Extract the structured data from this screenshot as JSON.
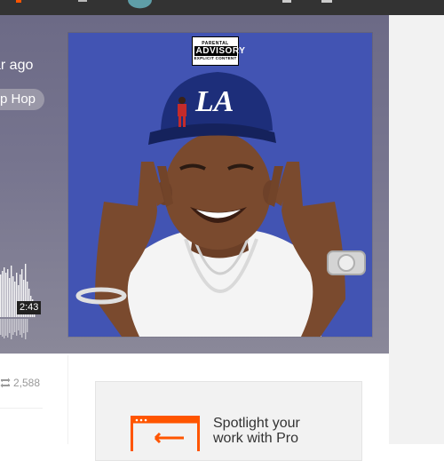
{
  "track": {
    "posted_ago": "ar ago",
    "genre_tag": "p Hop",
    "duration": "2:43"
  },
  "artwork": {
    "advisory_top": "PARENTAL",
    "advisory_middle": "ADVISORY",
    "advisory_bottom": "EXPLICIT CONTENT",
    "cap_logo": "LA",
    "background_color": "#4254b3"
  },
  "stats": {
    "reposts_icon": "repost-icon",
    "reposts_count": "2,588"
  },
  "promo": {
    "icon": "upload-icon",
    "line1": "Spotlight your",
    "line2": "work with Pro"
  },
  "colors": {
    "topbar": "#333333",
    "accent": "#ff5500",
    "hero_bg": "#77758f"
  }
}
